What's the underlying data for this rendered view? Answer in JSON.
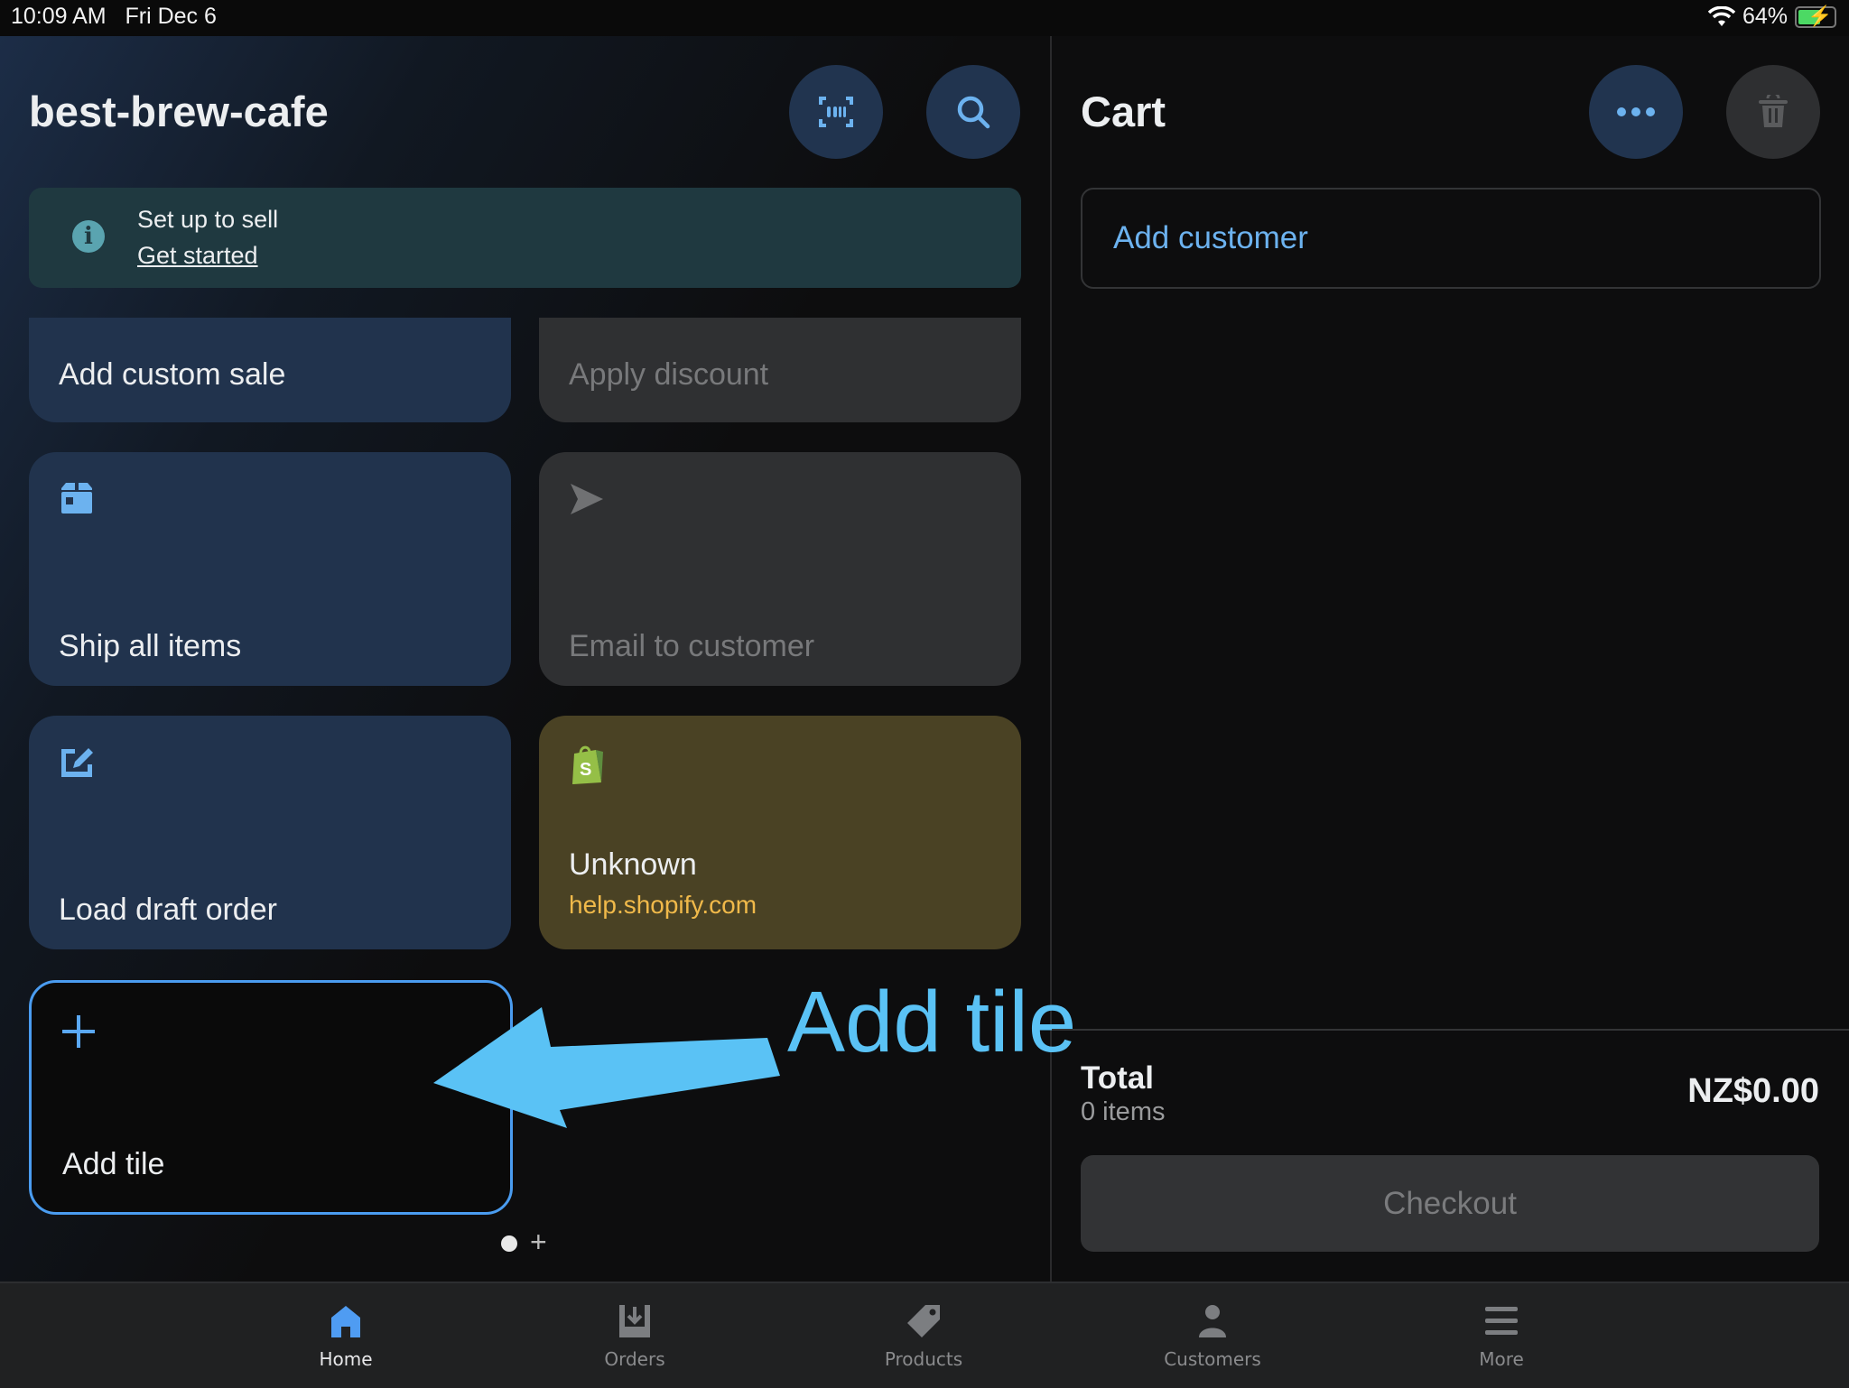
{
  "status_bar": {
    "time": "10:09 AM",
    "date": "Fri Dec 6",
    "battery": "64%",
    "battery_level": 0.64,
    "icons": [
      "wifi-icon",
      "battery-charging-icon"
    ]
  },
  "home": {
    "store_name": "best-brew-cafe",
    "scan_icon": "barcode-scan-icon",
    "search_icon": "search-icon",
    "banner": {
      "title": "Set up to sell",
      "link": "Get started",
      "icon": "info-icon"
    },
    "tiles": [
      {
        "label": "Add custom sale",
        "style": "blue"
      },
      {
        "label": "Apply discount",
        "style": "disabled"
      },
      {
        "label": "Ship all items",
        "style": "blue",
        "icon": "package-icon"
      },
      {
        "label": "Email to customer",
        "style": "disabled",
        "icon": "send-icon"
      },
      {
        "label": "Load draft order",
        "style": "blue",
        "icon": "edit-draft-icon"
      },
      {
        "label": "Unknown",
        "sublabel": "help.shopify.com",
        "style": "olive",
        "icon": "shopify-bag-icon"
      }
    ],
    "add_tile": {
      "label": "Add tile",
      "icon": "plus-icon"
    },
    "annotation": {
      "text": "Add tile",
      "color": "#5ac2f5"
    },
    "pagination": {
      "current_page": 1,
      "add_page": "+"
    }
  },
  "cart": {
    "title": "Cart",
    "more_icon": "ellipsis-icon",
    "clear_icon": "trash-icon",
    "add_customer": "Add customer",
    "total_label": "Total",
    "items_label": "0 items",
    "total_amount": "NZ$0.00",
    "checkout": "Checkout"
  },
  "tabbar": [
    {
      "label": "Home",
      "icon": "home-icon",
      "active": true
    },
    {
      "label": "Orders",
      "icon": "orders-inbox-icon",
      "active": false
    },
    {
      "label": "Products",
      "icon": "tag-icon",
      "active": false
    },
    {
      "label": "Customers",
      "icon": "person-icon",
      "active": false
    },
    {
      "label": "More",
      "icon": "menu-icon",
      "active": false
    }
  ],
  "colors": {
    "accent": "#4a9cf0",
    "link": "#6cb2ef",
    "tile_blue": "#21334d",
    "tile_disabled": "#2f3032",
    "tile_olive": "#4a4224",
    "url_text": "#f0b94a"
  }
}
